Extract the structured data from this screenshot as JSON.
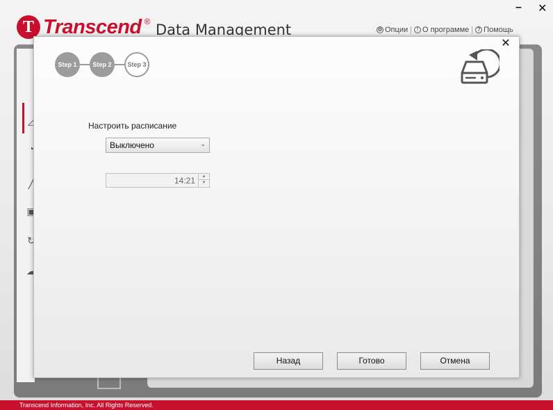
{
  "app": {
    "brand": "Transcend",
    "brand_mark": "T",
    "brand_reg": "®",
    "title": "Data Management",
    "menu": [
      {
        "icon": "gear-icon",
        "label": "Опции"
      },
      {
        "icon": "info-icon",
        "label": "О программе"
      },
      {
        "icon": "help-icon",
        "label": "Помощь"
      }
    ],
    "minimize": "–",
    "close": "✕",
    "footer": "Transcend Information, Inc. All Rights Reserved.",
    "brand_color": "#c8102e"
  },
  "dialog": {
    "close": "✕",
    "steps": [
      {
        "label": "Step 1",
        "state": "done"
      },
      {
        "label": "Step 2",
        "state": "done"
      },
      {
        "label": "Step 3",
        "state": "active"
      }
    ],
    "header_icon": "drive-restore-icon",
    "schedule_label": "Настроить расписание",
    "schedule_value": "Выключено",
    "time_value": "14:21",
    "buttons": {
      "back": "Назад",
      "done": "Готово",
      "cancel": "Отмена"
    }
  }
}
